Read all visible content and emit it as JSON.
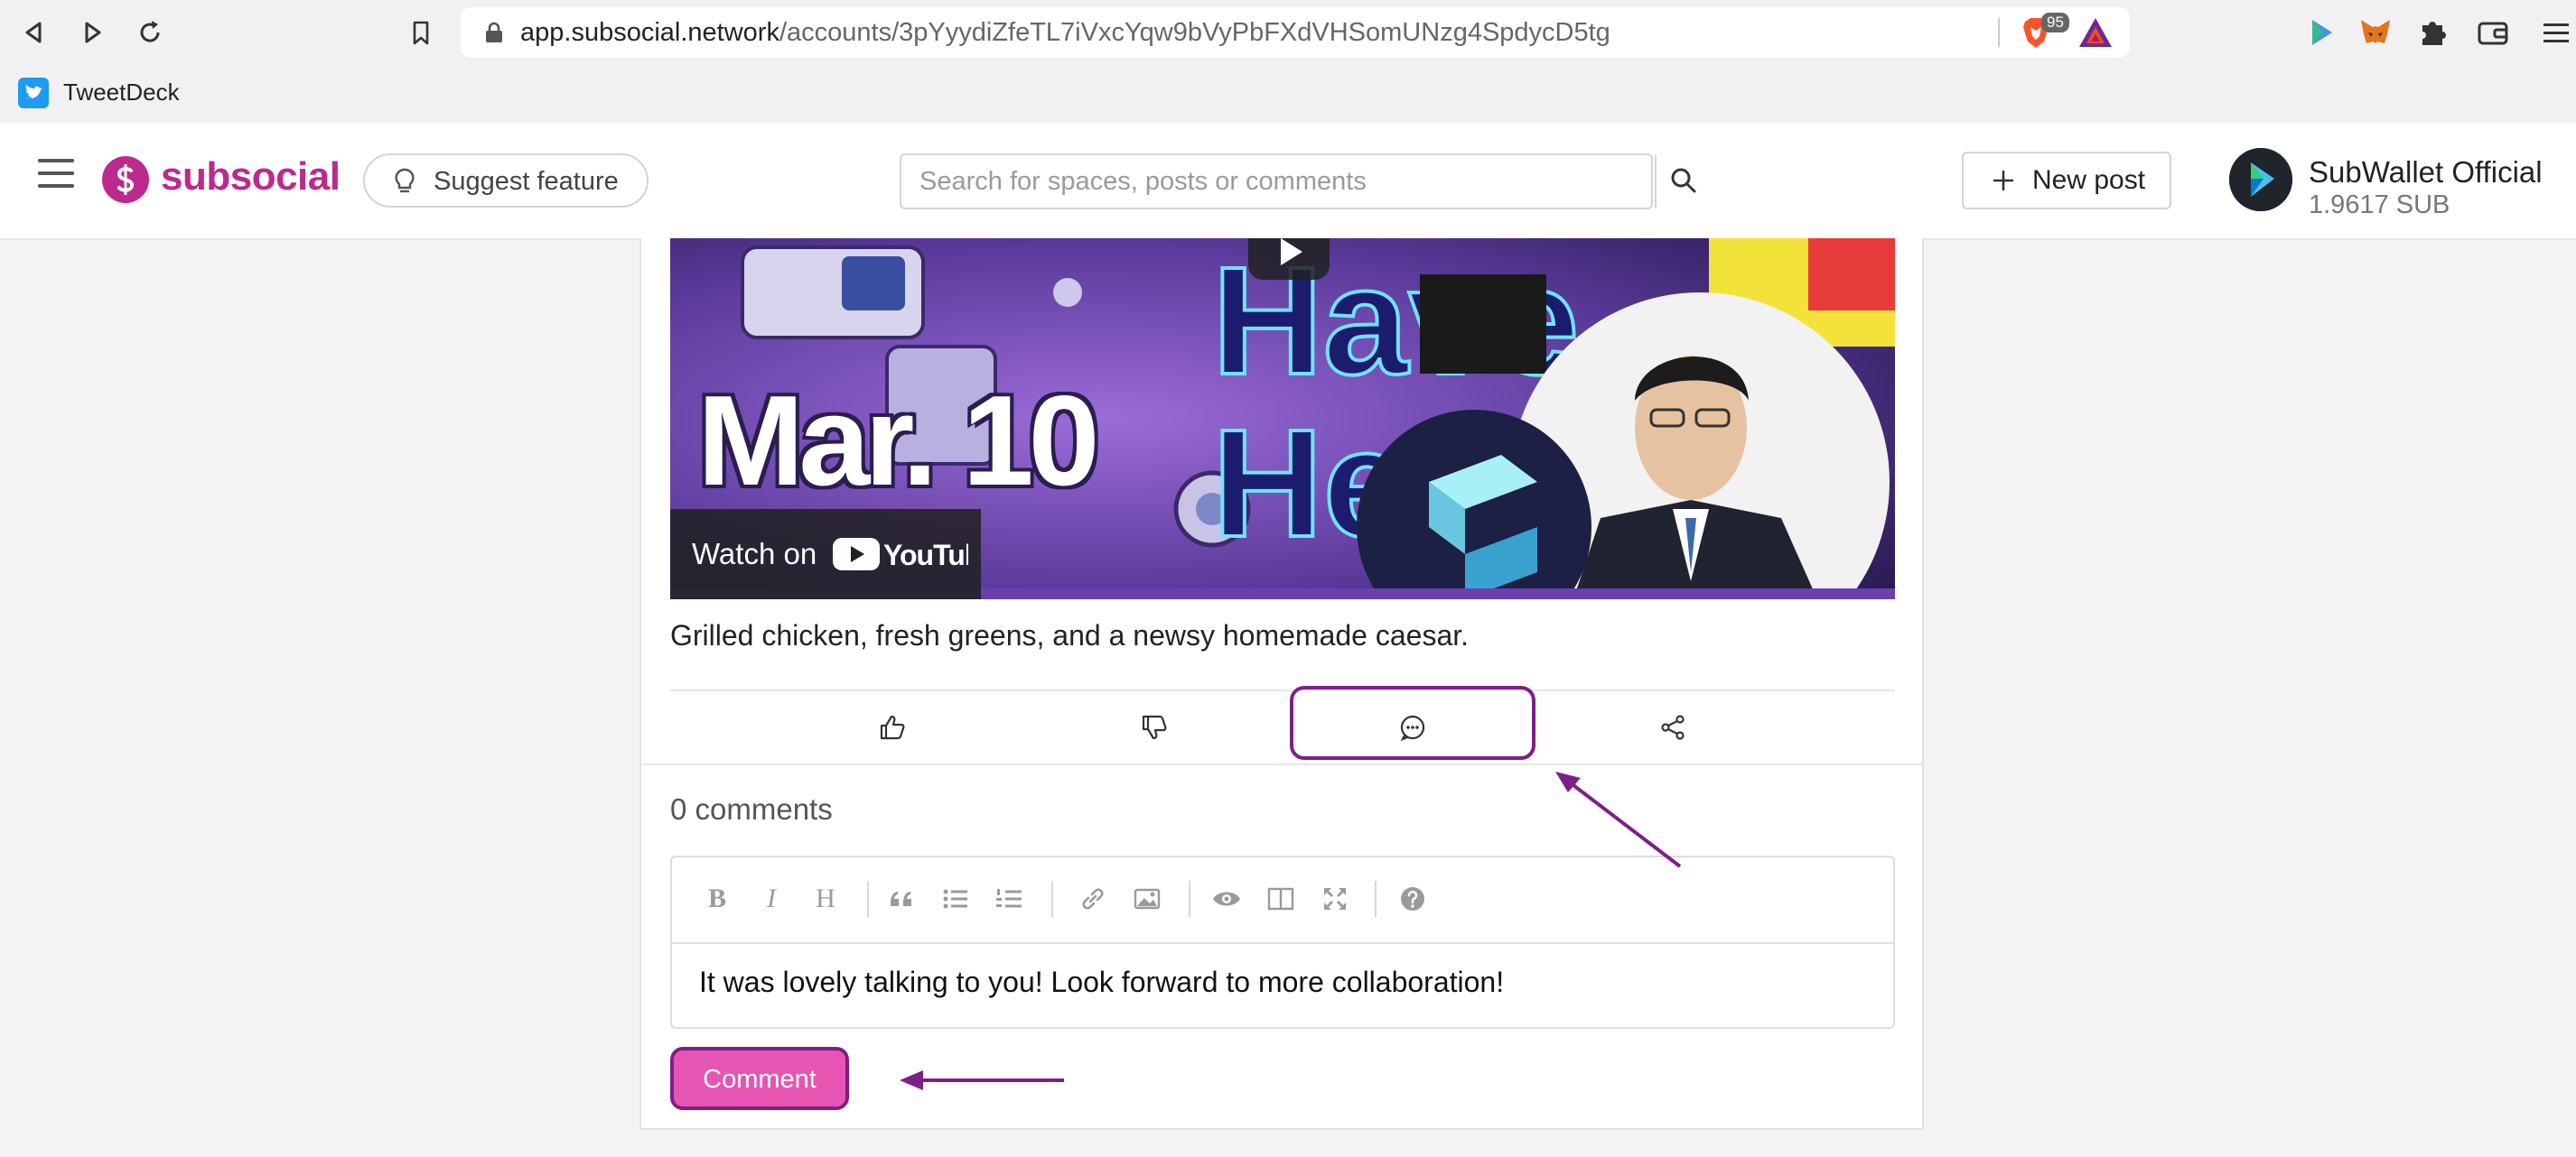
{
  "browser": {
    "url_host": "app.subsocial.network",
    "url_path": "/accounts/3pYyydiZfeTL7iVxcYqw9bVyPbFXdVHSomUNzg4SpdycD5tg",
    "brave_badge": "95",
    "bookmark": "TweetDeck"
  },
  "header": {
    "logo": "subsocial",
    "suggest": "Suggest feature",
    "search_placeholder": "Search for spaces, posts or comments",
    "new_post": "New post",
    "account_name": "SubWallet Official",
    "account_balance": "1.9617 SUB"
  },
  "post": {
    "video_date": "Mar. 10",
    "watch_on": "Watch on",
    "youtube": "YouTube",
    "body": "Grilled chicken, fresh greens, and a newsy homemade caesar."
  },
  "comments": {
    "count": "0 comments",
    "draft": "It was lovely talking to you! Look forward to more collaboration!",
    "submit": "Comment"
  },
  "colors": {
    "brand": "#bc2a8d",
    "highlight": "#7e1f87",
    "button": "#e755b2"
  }
}
